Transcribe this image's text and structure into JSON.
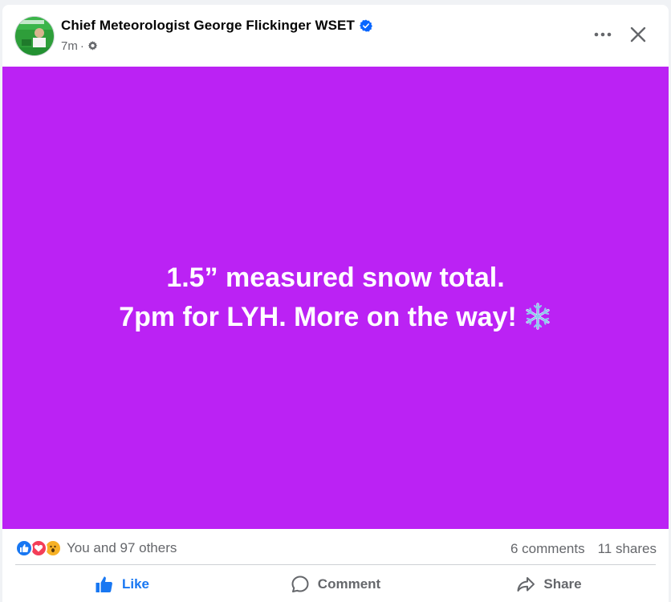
{
  "post": {
    "author": "Chief Meteorologist George Flickinger WSET",
    "time": "7m",
    "separator": "·",
    "text_lines": [
      "1.5” measured snow total.",
      "7pm for LYH. More on the way!"
    ],
    "background_color": "#bb22f4"
  },
  "stats": {
    "reactions_text": "You and 97 others",
    "comments": "6 comments",
    "shares": "11 shares"
  },
  "actions": {
    "like": "Like",
    "comment": "Comment",
    "share": "Share"
  },
  "icons": {
    "verified": "verified-badge-icon",
    "audience": "gear-icon",
    "more": "more-options-icon",
    "close": "close-icon",
    "snow": "snowflake-icon"
  },
  "colors": {
    "accent": "#1877f2",
    "love": "#f33e58",
    "wow": "#f7b125"
  }
}
